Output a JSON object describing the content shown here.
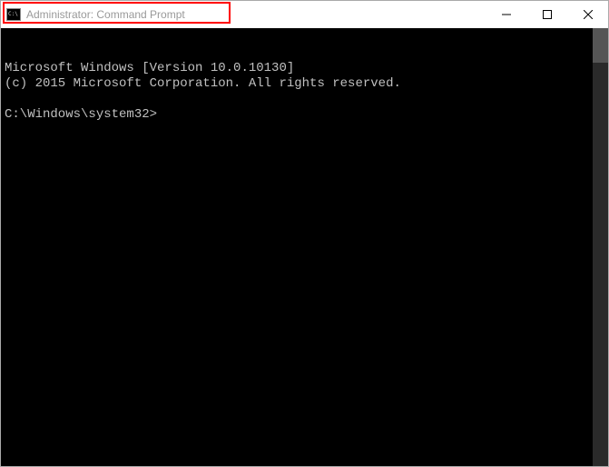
{
  "titlebar": {
    "icon_label": "C:\\",
    "title": "Administrator: Command Prompt"
  },
  "console": {
    "line1": "Microsoft Windows [Version 10.0.10130]",
    "line2": "(c) 2015 Microsoft Corporation. All rights reserved.",
    "blank": "",
    "prompt": "C:\\Windows\\system32>"
  }
}
